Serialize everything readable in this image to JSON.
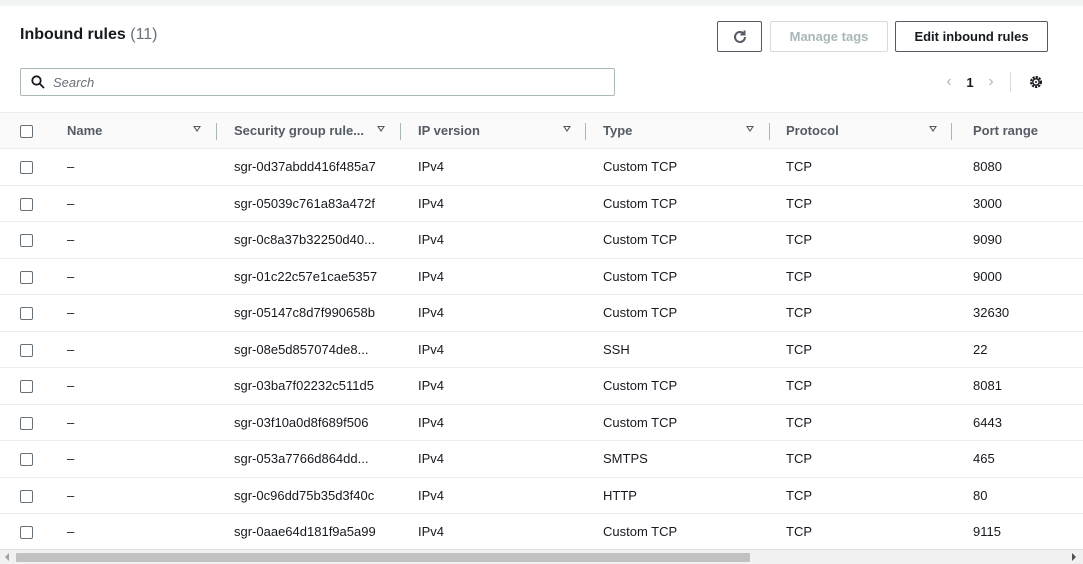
{
  "header": {
    "title": "Inbound rules",
    "count": "(11)"
  },
  "toolbar": {
    "manage_tags": "Manage tags",
    "edit_inbound": "Edit inbound rules"
  },
  "search": {
    "placeholder": "Search"
  },
  "pagination": {
    "page": "1"
  },
  "columns": [
    "Name",
    "Security group rule...",
    "IP version",
    "Type",
    "Protocol",
    "Port range"
  ],
  "rows": [
    {
      "name": "–",
      "sgr": "sgr-0d37abdd416f485a7",
      "ip": "IPv4",
      "type": "Custom TCP",
      "protocol": "TCP",
      "port": "8080"
    },
    {
      "name": "–",
      "sgr": "sgr-05039c761a83a472f",
      "ip": "IPv4",
      "type": "Custom TCP",
      "protocol": "TCP",
      "port": "3000"
    },
    {
      "name": "–",
      "sgr": "sgr-0c8a37b32250d40...",
      "ip": "IPv4",
      "type": "Custom TCP",
      "protocol": "TCP",
      "port": "9090"
    },
    {
      "name": "–",
      "sgr": "sgr-01c22c57e1cae5357",
      "ip": "IPv4",
      "type": "Custom TCP",
      "protocol": "TCP",
      "port": "9000"
    },
    {
      "name": "–",
      "sgr": "sgr-05147c8d7f990658b",
      "ip": "IPv4",
      "type": "Custom TCP",
      "protocol": "TCP",
      "port": "32630"
    },
    {
      "name": "–",
      "sgr": "sgr-08e5d857074de8...",
      "ip": "IPv4",
      "type": "SSH",
      "protocol": "TCP",
      "port": "22"
    },
    {
      "name": "–",
      "sgr": "sgr-03ba7f02232c511d5",
      "ip": "IPv4",
      "type": "Custom TCP",
      "protocol": "TCP",
      "port": "8081"
    },
    {
      "name": "–",
      "sgr": "sgr-03f10a0d8f689f506",
      "ip": "IPv4",
      "type": "Custom TCP",
      "protocol": "TCP",
      "port": "6443"
    },
    {
      "name": "–",
      "sgr": "sgr-053a7766d864dd...",
      "ip": "IPv4",
      "type": "SMTPS",
      "protocol": "TCP",
      "port": "465"
    },
    {
      "name": "–",
      "sgr": "sgr-0c96dd75b35d3f40c",
      "ip": "IPv4",
      "type": "HTTP",
      "protocol": "TCP",
      "port": "80"
    },
    {
      "name": "–",
      "sgr": "sgr-0aae64d181f9a5a99",
      "ip": "IPv4",
      "type": "Custom TCP",
      "protocol": "TCP",
      "port": "9115"
    }
  ]
}
